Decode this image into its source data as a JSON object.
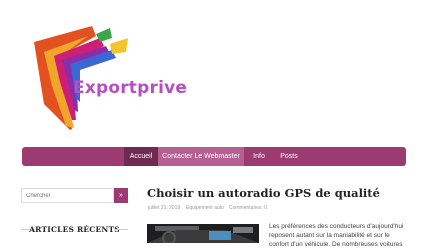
{
  "site": {
    "brand": "Exportprive"
  },
  "colors": {
    "accent": "#9c3b72",
    "active": "#6f2a52",
    "highlight": "#b55f93",
    "brand_text": "#b64fc0"
  },
  "nav": {
    "items": [
      {
        "label": "Accueil",
        "state": "active"
      },
      {
        "label": "Contacter Le Webmaster",
        "state": "highlighted"
      },
      {
        "label": "Info"
      },
      {
        "label": "Posts"
      }
    ]
  },
  "sidebar": {
    "search_placeholder": "Chercher",
    "search_button": "»",
    "recent_title": "ARTICLES RÉCENTS"
  },
  "post": {
    "title": "Choisir un autoradio GPS de qualité",
    "date": "juillet 31, 2019",
    "category": "Equipement auto",
    "comments": "Commentaires: 0",
    "excerpt": "Les préférences des conducteurs d'aujourd'hui reposent autant sur la maniabilité et sur le confort d'un véhicule. De nombreuses voitures"
  }
}
